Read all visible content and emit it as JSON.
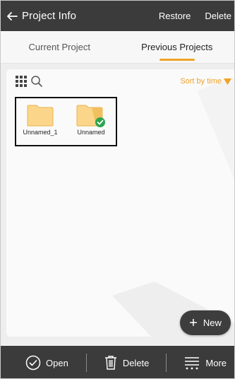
{
  "header": {
    "title": "Project Info",
    "restore_label": "Restore",
    "delete_label": "Delete"
  },
  "tabs": [
    {
      "label": "Current Project",
      "active": false
    },
    {
      "label": "Previous Projects",
      "active": true
    }
  ],
  "toolbar": {
    "sort_label": "Sort by time"
  },
  "files": [
    {
      "name": "Unnamed_1",
      "icon": "folder-icon",
      "selected": false
    },
    {
      "name": "Unnamed",
      "icon": "folder-icon",
      "selected": true
    }
  ],
  "new_button": {
    "label": "New"
  },
  "bottom_bar": {
    "open_label": "Open",
    "delete_label": "Delete",
    "more_label": "More"
  },
  "colors": {
    "bar": "#3b3b3b",
    "accent": "#f0a226",
    "folder": "#fbd68a",
    "check": "#2ea44f"
  }
}
